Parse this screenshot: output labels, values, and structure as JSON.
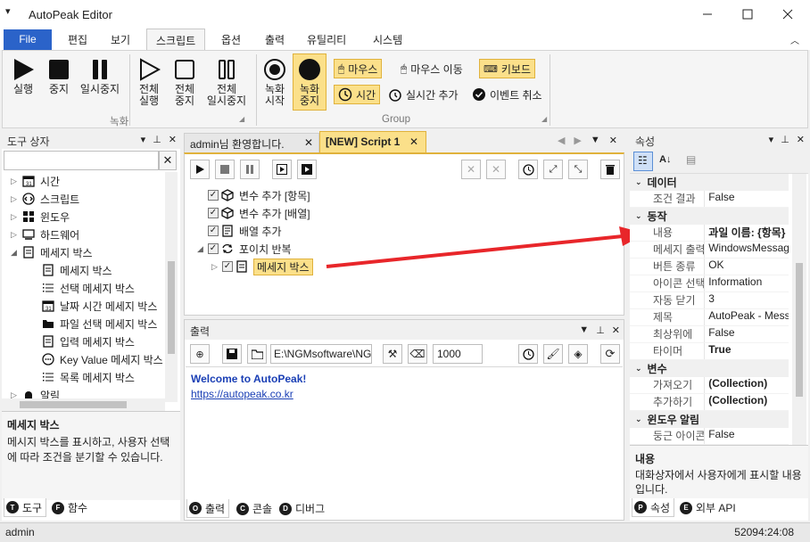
{
  "window": {
    "title": "AutoPeak Editor"
  },
  "ribbon_tabs": [
    "File",
    "편집",
    "보기",
    "스크립트",
    "옵션",
    "출력",
    "유틸리티",
    "시스템"
  ],
  "ribbon": {
    "run": "실행",
    "stop": "중지",
    "pause": "일시중지",
    "run_all": [
      "전체",
      "실행"
    ],
    "stop_all": [
      "전체",
      "중지"
    ],
    "pause_all": [
      "전체",
      "일시중지"
    ],
    "group1_label": "녹화",
    "rec_start": [
      "녹화",
      "시작"
    ],
    "rec_stop": [
      "녹화",
      "중지"
    ],
    "mouse": "마우스",
    "mouse_move": "마우스 이동",
    "keyboard": "키보드",
    "time": "시간",
    "realtime_add": "실시간 추가",
    "event_cancel": "이벤트 취소",
    "group2_label": "Group"
  },
  "toolbox": {
    "title": "도구 상자",
    "search_placeholder": "",
    "items": [
      {
        "label": "시간",
        "icon": "calendar-icon",
        "level": 0
      },
      {
        "label": "스크립트",
        "icon": "code-icon",
        "level": 0
      },
      {
        "label": "윈도우",
        "icon": "windows-icon",
        "level": 0
      },
      {
        "label": "하드웨어",
        "icon": "computer-icon",
        "level": 0
      },
      {
        "label": "메세지 박스",
        "icon": "message-icon",
        "level": 0,
        "expanded": true
      },
      {
        "label": "메세지 박스",
        "icon": "message-icon",
        "level": 1
      },
      {
        "label": "선택 메세지 박스",
        "icon": "list-icon",
        "level": 1
      },
      {
        "label": "날짜 시간 메세지 박스",
        "icon": "calendar-icon",
        "level": 1
      },
      {
        "label": "파일 선택 메세지 박스",
        "icon": "folder-icon",
        "level": 1
      },
      {
        "label": "입력 메세지 박스",
        "icon": "message-icon",
        "level": 1
      },
      {
        "label": "Key Value 메세지 박스",
        "icon": "dots-icon",
        "level": 1
      },
      {
        "label": "목록 메세지 박스",
        "icon": "list-icon",
        "level": 1
      },
      {
        "label": "알림",
        "icon": "bell-icon",
        "level": 0
      }
    ],
    "desc_title": "메세지 박스",
    "desc_text": "메시지 박스를 표시하고, 사용자 선택에 따라 조건을 분기할 수 있습니다.",
    "tabs": [
      "도구",
      "함수"
    ]
  },
  "editor": {
    "tabs": [
      "admin님 환영합니다.",
      "[NEW] Script 1"
    ],
    "tree": [
      {
        "label": "변수 추가 [항목]",
        "icon": "cube-icon",
        "level": 0
      },
      {
        "label": "변수 추가 [배열]",
        "icon": "cube-icon",
        "level": 0
      },
      {
        "label": "배열 추가",
        "icon": "array-icon",
        "level": 0
      },
      {
        "label": "포이치 반복",
        "icon": "loop-icon",
        "level": 0
      },
      {
        "label": "메세지 박스",
        "icon": "message-icon",
        "level": 1
      }
    ]
  },
  "output": {
    "title": "출력",
    "path": "E:\\NGMsoftware\\NG",
    "count": "1000",
    "welcome": "Welcome to AutoPeak!",
    "link": "https://autopeak.co.kr",
    "tabs": [
      "출력",
      "콘솔",
      "디버그"
    ]
  },
  "properties": {
    "title": "속성",
    "categories": [
      {
        "name": "데이터",
        "rows": [
          {
            "k": "조건 결과",
            "v": "False",
            "bold": false
          }
        ]
      },
      {
        "name": "동작",
        "rows": [
          {
            "k": "내용",
            "v": "과일 이름: {항목}",
            "bold": true
          },
          {
            "k": "메세지 출력",
            "v": "WindowsMessage",
            "bold": false
          },
          {
            "k": "버튼 종류",
            "v": "OK",
            "bold": false
          },
          {
            "k": "아이콘 선택",
            "v": "Information",
            "bold": false
          },
          {
            "k": "자동 닫기",
            "v": "3",
            "bold": false
          },
          {
            "k": "제목",
            "v": "AutoPeak - Messa",
            "bold": false
          },
          {
            "k": "최상위에",
            "v": "False",
            "bold": false
          },
          {
            "k": "타이머",
            "v": "True",
            "bold": true
          }
        ]
      },
      {
        "name": "변수",
        "rows": [
          {
            "k": "가져오기",
            "v": "(Collection)",
            "bold": true
          },
          {
            "k": "추가하기",
            "v": "(Collection)",
            "bold": true
          }
        ]
      },
      {
        "name": "윈도우 알림",
        "rows": [
          {
            "k": "둥근 아이콘",
            "v": "False",
            "bold": false
          }
        ]
      }
    ],
    "desc_title": "내용",
    "desc_text": "대화상자에서 사용자에게 표시할 내용입니다.",
    "tabs": [
      "속성",
      "외부 API"
    ]
  },
  "status": {
    "user": "admin",
    "timer": "52094:24:08"
  },
  "colors": {
    "accent": "#2b63c9",
    "highlight": "#fbe08a",
    "arrow": "#e8262a",
    "link": "#1a3fb5"
  }
}
